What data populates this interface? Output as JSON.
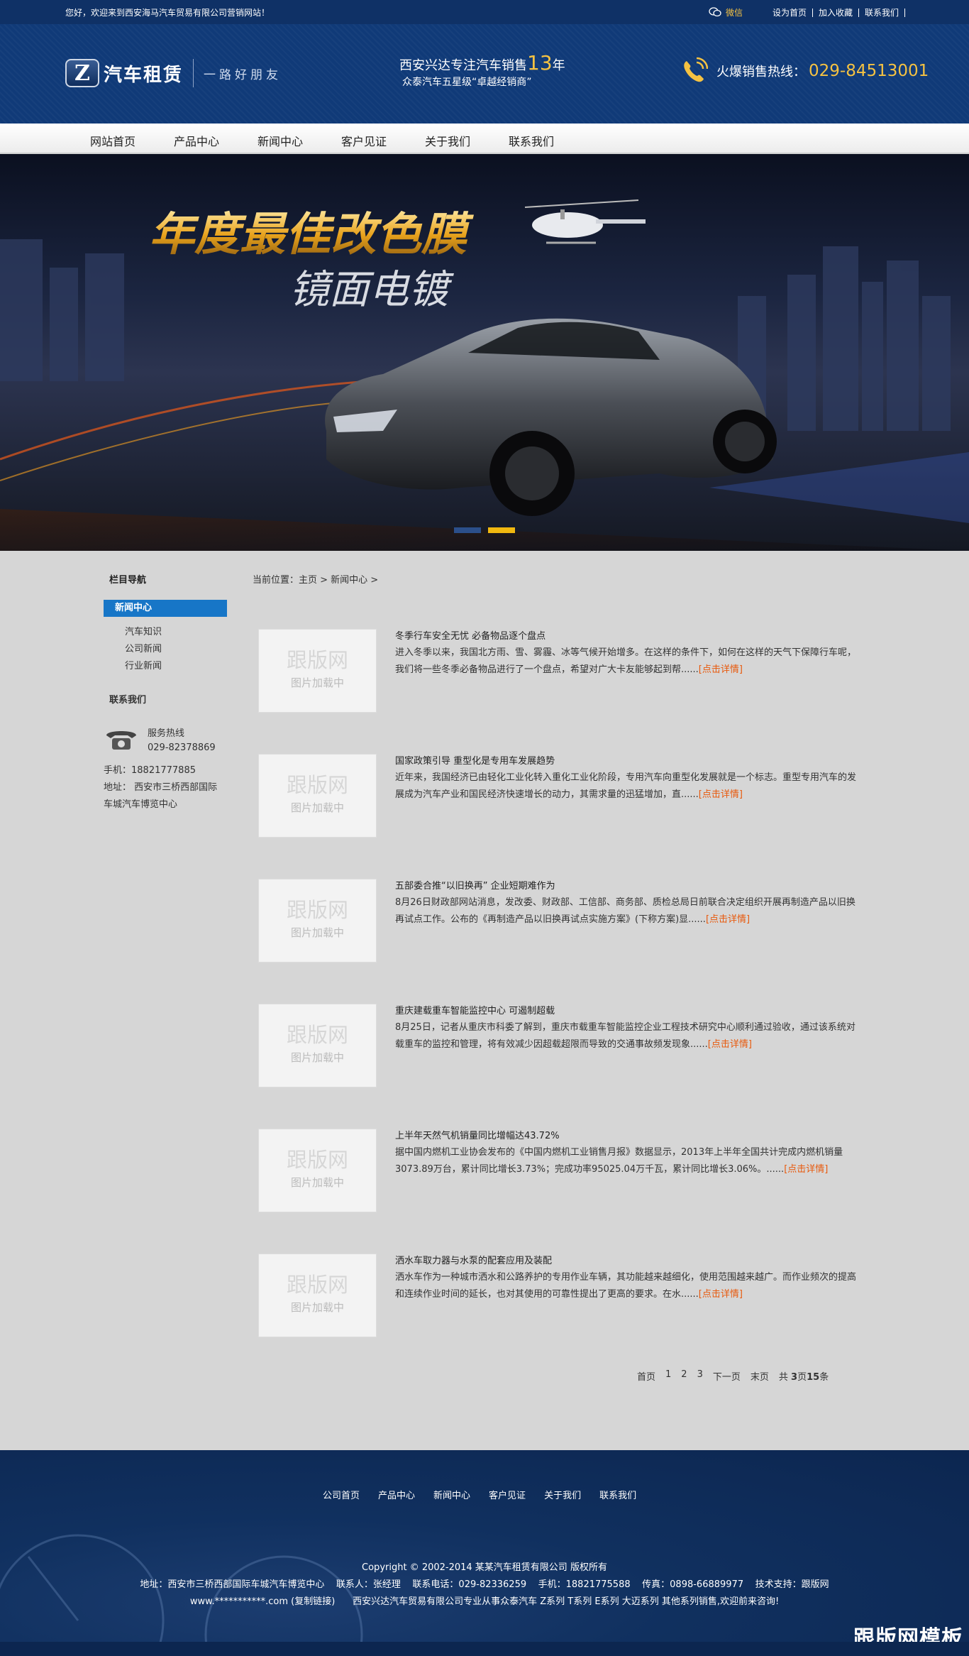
{
  "topbar": {
    "welcome": "您好，欢迎来到西安海马汽车贸易有限公司营销网站！",
    "wechat": "微信",
    "links": [
      "设为首页",
      "加入收藏",
      "联系我们"
    ]
  },
  "header": {
    "logo_mark": "Z",
    "logo_name": "汽车租赁",
    "logo_slogan": "一路好朋友",
    "mid_line1_prefix": "西安兴达专注汽车销售",
    "mid_years": "13",
    "mid_line1_suffix": "年",
    "mid_line2": "众泰汽车五星级“卓越经销商”",
    "hotline_label": "火爆销售热线：",
    "hotline_number": "029-84513001"
  },
  "nav": [
    "网站首页",
    "产品中心",
    "新闻中心",
    "客户见证",
    "关于我们",
    "联系我们"
  ],
  "banner": {
    "headline": "年度最佳改色膜",
    "subline": "镜面电镀",
    "active_slide": 2,
    "slide_count": 2
  },
  "sidebar": {
    "title": "栏目导航",
    "active": "新闻中心",
    "subitems": [
      "汽车知识",
      "公司新闻",
      "行业新闻"
    ],
    "contact_title": "联系我们",
    "service_label": "服务热线",
    "service_number": "029-82378869",
    "mobile": "手机：18821777885",
    "address_line1": "地址： 西安市三桥西部国际",
    "address_line2": "车城汽车博览中心"
  },
  "breadcrumb": "当前位置：主页 > 新闻中心 >",
  "thumb": {
    "brand": "跟版网",
    "loading": "图片加载中"
  },
  "news": [
    {
      "title": "冬季行车安全无忧 必备物品逐个盘点",
      "desc": "进入冬季以来，我国北方雨、雪、雾霾、冰等气候开始增多。在这样的条件下，如何在这样的天气下保障行车呢，我们将一些冬季必备物品进行了一个盘点，希望对广大卡友能够起到帮......",
      "more": "[点击详情]"
    },
    {
      "title": "国家政策引导 重型化是专用车发展趋势",
      "desc": "近年来，我国经济已由轻化工业化转入重化工业化阶段，专用汽车向重型化发展就是一个标志。重型专用汽车的发展成为汽车产业和国民经济快速增长的动力，其需求量的迅猛增加，直......",
      "more": "[点击详情]"
    },
    {
      "title": "五部委合推“以旧换再” 企业短期难作为",
      "desc": "8月26日财政部网站消息，发改委、财政部、工信部、商务部、质检总局日前联合决定组织开展再制造产品以旧换再试点工作。公布的《再制造产品以旧换再试点实施方案》(下称方案)显......",
      "more": "[点击详情]"
    },
    {
      "title": "重庆建载重车智能监控中心 可遏制超载",
      "desc": "8月25日，记者从重庆市科委了解到，重庆市载重车智能监控企业工程技术研究中心顺利通过验收，通过该系统对载重车的监控和管理，将有效减少因超载超限而导致的交通事故频发现象......",
      "more": "[点击详情]"
    },
    {
      "title": "上半年天然气机销量同比增幅达43.72%",
      "desc": "据中国内燃机工业协会发布的《中国内燃机工业销售月报》数据显示，2013年上半年全国共计完成内燃机销量3073.89万台，累计同比增长3.73%；完成功率95025.04万千瓦，累计同比增长3.06%。......",
      "more": "[点击详情]"
    },
    {
      "title": "洒水车取力器与水泵的配套应用及装配",
      "desc": "洒水车作为一种城市洒水和公路养护的专用作业车辆，其功能越来越细化，使用范围越来越广。而作业频次的提高和连续作业时间的延长，也对其使用的可靠性提出了更高的要求。在水......",
      "more": "[点击详情]"
    }
  ],
  "pager": {
    "first": "首页",
    "pages": [
      "1",
      "2",
      "3"
    ],
    "next": "下一页",
    "last": "末页",
    "total_prefix": "共",
    "total_pages": "3",
    "total_mid": "页",
    "total_items": "15",
    "total_suffix": "条"
  },
  "footer": {
    "nav": [
      "公司首页",
      "产品中心",
      "新闻中心",
      "客户见证",
      "关于我们",
      "联系我们"
    ],
    "copyright": "Copyright © 2002-2014 某某汽车租赁有限公司 版权所有",
    "contact_line": "地址：西安市三桥西部国际车城汽车博览中心    联系人：张经理    联系电话：029-82336259    手机：18821775588    传真：0898-66889977    技术支持：跟版网",
    "domain_line": "www.***********.com (复制链接)      西安兴达汽车贸易有限公司专业从事众泰汽车 Z系列 T系列 E系列 大迈系列 其他系列销售,欢迎前来咨询!",
    "watermark": "跟版网模板"
  },
  "colors": {
    "header_bg": "#103a78",
    "accent_gold": "#f5c242",
    "active_blue": "#1776c7",
    "more_orange": "#e8590c"
  }
}
